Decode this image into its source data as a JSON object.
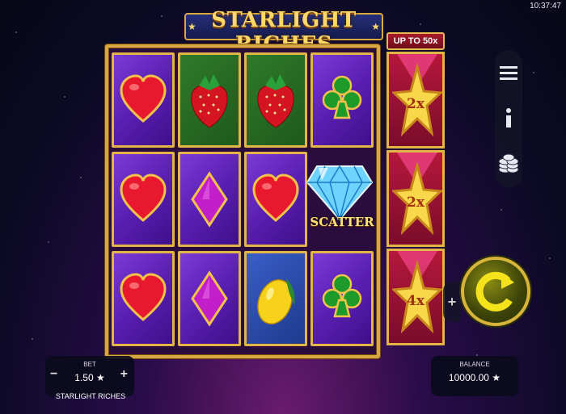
{
  "clock": "10:37:47",
  "game_title": "STARLIGHT RICHES",
  "multiplier_header": "UP TO 50x",
  "reels": [
    [
      "heart",
      "heart",
      "heart"
    ],
    [
      "strawberry",
      "diamond",
      "diamond"
    ],
    [
      "strawberry",
      "heart",
      "lemon"
    ],
    [
      "club",
      "scatter",
      "club"
    ]
  ],
  "scatter_label": "SCATTER",
  "multipliers": [
    "2x",
    "2x",
    "4x"
  ],
  "bet": {
    "label": "BET",
    "value": "1.50 ★",
    "minus": "−",
    "plus": "+"
  },
  "game_name": "STARLIGHT RICHES",
  "balance": {
    "label": "BALANCE",
    "value": "10000.00 ★"
  },
  "spin_plus": "+",
  "icons": [
    "menu-icon",
    "info-icon",
    "coins-icon",
    "spin-icon"
  ],
  "colors": {
    "gold": "#e3b546",
    "heart": "#e8182e",
    "diamond_purple": "#c21ec9",
    "club": "#1e9a2a",
    "spin": "#f4e21a"
  }
}
